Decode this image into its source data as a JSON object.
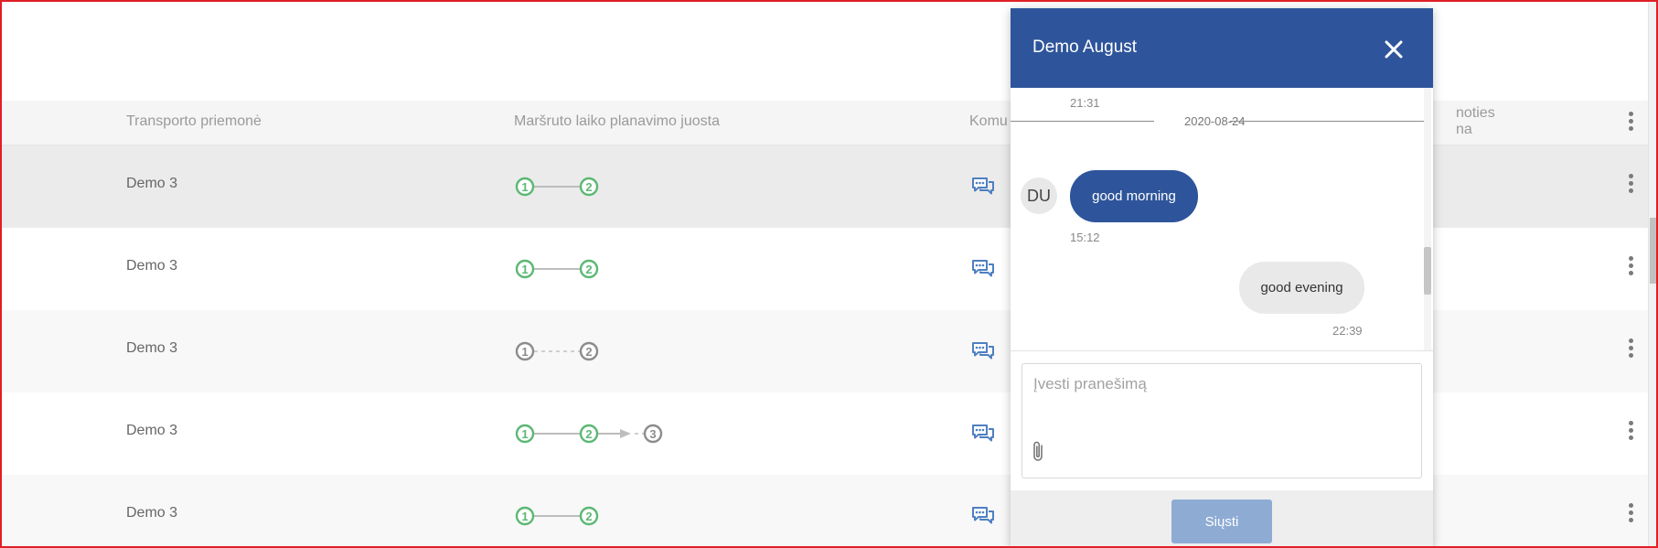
{
  "table": {
    "columns": {
      "vehicle": "Transporto priemonė",
      "route": "Maršruto laiko planavimo juosta",
      "communication": "Komu",
      "last_line1": "noties",
      "last_line2": "na"
    },
    "rows": [
      {
        "vehicle": "Demo 3",
        "stops": [
          {
            "n": "1",
            "state": "done"
          },
          {
            "n": "2",
            "state": "done"
          }
        ],
        "connectors": [
          "solid"
        ]
      },
      {
        "vehicle": "Demo 3",
        "stops": [
          {
            "n": "1",
            "state": "done"
          },
          {
            "n": "2",
            "state": "done"
          }
        ],
        "connectors": [
          "solid"
        ]
      },
      {
        "vehicle": "Demo 3",
        "stops": [
          {
            "n": "1",
            "state": "pending"
          },
          {
            "n": "2",
            "state": "pending"
          }
        ],
        "connectors": [
          "dashed"
        ]
      },
      {
        "vehicle": "Demo 3",
        "stops": [
          {
            "n": "1",
            "state": "done"
          },
          {
            "n": "2",
            "state": "done"
          },
          {
            "n": "3",
            "state": "pending"
          }
        ],
        "connectors": [
          "solid",
          "arrow-dashed"
        ]
      },
      {
        "vehicle": "Demo 3",
        "stops": [
          {
            "n": "1",
            "state": "done"
          },
          {
            "n": "2",
            "state": "done"
          }
        ],
        "connectors": [
          "solid"
        ]
      }
    ],
    "icons": {
      "comment": "chat-bubbles-icon",
      "menu": "more-vert-icon"
    }
  },
  "chat": {
    "title": "Demo August",
    "close_icon": "close-icon",
    "first_time": "21:31",
    "date_separator": "2020-08-24",
    "avatar_initials": "DU",
    "incoming": {
      "text": "good morning",
      "time": "15:12"
    },
    "outgoing": {
      "text": "good evening",
      "time": "22:39"
    },
    "input_placeholder": "Įvesti pranešimą",
    "attach_icon": "paperclip-icon",
    "send_label": "Siųsti"
  },
  "colors": {
    "primary": "#2e559b",
    "send_disabled": "#8eabd4",
    "stop_done": "#5cb874",
    "stop_pending": "#8c8c8c",
    "comment_icon": "#4f7fc1"
  }
}
